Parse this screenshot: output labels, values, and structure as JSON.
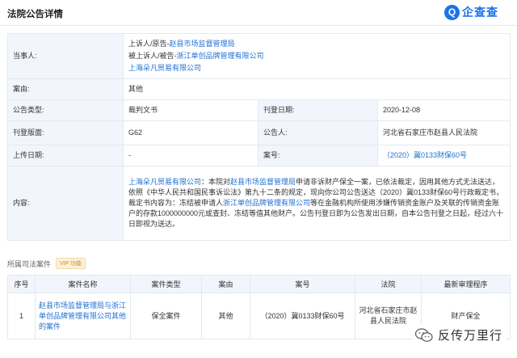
{
  "header": {
    "title": "法院公告详情",
    "logo_mark": "Q",
    "logo_text": "企查查"
  },
  "detail": {
    "party_label": "当事人:",
    "party": {
      "line1_prefix": "上诉人/原告-",
      "line1_name": "赵县市场监督管理局",
      "line2_prefix": "被上诉人/被告-",
      "line2_name": "浙江单创品牌管理有限公司",
      "line3_name": "上海朵凡贸易有限公司"
    },
    "cause_label": "案由:",
    "cause_value": "其他",
    "type_label": "公告类型:",
    "type_value": "裁判文书",
    "pubdate_label": "刊登日期:",
    "pubdate_value": "2020-12-08",
    "layout_label": "刊登版面:",
    "layout_value": "G62",
    "announcer_label": "公告人:",
    "announcer_value": "河北省石家庄市赵县人民法院",
    "upload_label": "上传日期:",
    "upload_value": "-",
    "caseno_label": "案号:",
    "caseno_value": "（2020）冀0133财保60号",
    "content_label": "内容:",
    "content": {
      "p1_link": "上海朵凡贸易有限公司",
      "p1_text": "：本院对",
      "p2_link": "赵县市场监督管理局",
      "p2_text": "申请非诉财产保全一案，已依法裁定，因用其他方式无法送达，依照《中华人民共和国民事诉讼法》第九十二条的规定，现向你公司公告送达（2020）冀0133财保60号行政裁定书，裁定书内容为：冻结被申请人",
      "p3_link": "浙江单创品牌管理有限公司",
      "p3_text": "等在金融机构所使用涉嫌传销资金账户及关联的传销资金账户的存款1000000000元或查封、冻结等值其他财产。公告刊登日即为公告发出日期，自本公告刊登之日起，经过六十日即视为送达。"
    }
  },
  "related": {
    "title": "所属司法案件",
    "vip": "VIP 功能"
  },
  "cases": {
    "headers": [
      "序号",
      "案件名称",
      "案件类型",
      "案由",
      "案号",
      "法院",
      "最新审理程序"
    ],
    "row": {
      "index": "1",
      "name": "赵县市场监督管理局与浙江单创品牌管理有限公司其他的案件",
      "type": "保全案件",
      "cause": "其他",
      "caseno": "（2020）冀0133财保60号",
      "court": "河北省石家庄市赵县人民法院",
      "procedure": "财产保全"
    }
  },
  "watermark": {
    "text": "反传万里行",
    "icon": "wechat-icon"
  }
}
